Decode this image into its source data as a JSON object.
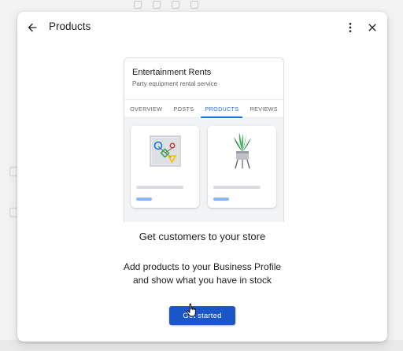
{
  "dialog": {
    "title": "Products",
    "back_icon": "arrow-left-icon",
    "more_icon": "more-vert-icon",
    "close_icon": "close-icon"
  },
  "preview": {
    "business_name": "Entertainment Rents",
    "business_description": "Party equipment rental service",
    "tabs": [
      {
        "label": "OVERVIEW",
        "active": false
      },
      {
        "label": "POSTS",
        "active": false
      },
      {
        "label": "PRODUCTS",
        "active": true
      },
      {
        "label": "REVIEWS",
        "active": false
      }
    ],
    "product_images": [
      "party-shapes-icon",
      "potted-plant-icon"
    ]
  },
  "content": {
    "headline": "Get customers to your store",
    "description_line1": "Add products to your Business Profile",
    "description_line2": "and show what you have in stock"
  },
  "cta": {
    "label": "Get started"
  },
  "colors": {
    "accent": "#1a73e8",
    "button": "#1a56c8",
    "placeholder_blue": "#8ab4f8",
    "placeholder_gray": "#dadce0"
  }
}
